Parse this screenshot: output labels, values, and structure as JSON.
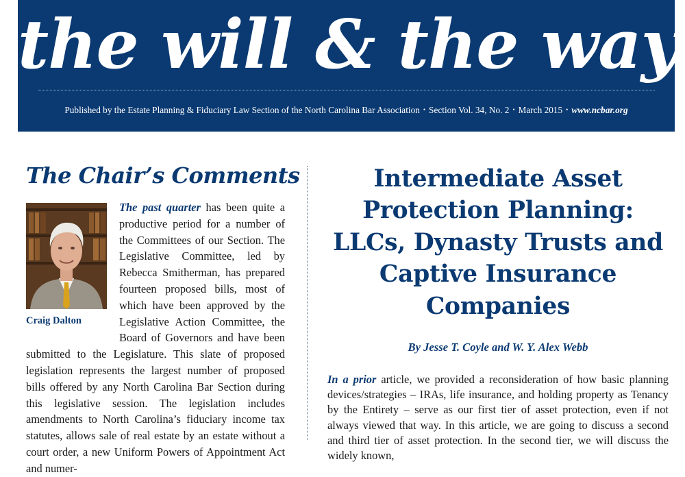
{
  "masthead": {
    "title": "the will & the way",
    "publisher": "Published by the Estate Planning & Fiduciary Law Section of the North Carolina Bar Association",
    "volume": "Section Vol. 34, No. 2",
    "date": "March 2015",
    "url": "www.ncbar.org",
    "separator": "•",
    "bg_color": "#0b3a72"
  },
  "chair": {
    "heading": "The Chair’s Comments",
    "photo_caption": "Craig Dalton",
    "lead": "The past quarter",
    "body": " has been quite a productive period for a number of the Committees of our Section. The Legislative Committee, led by Rebecca Smitherman, has prepared fourteen proposed bills, most of which have been approved by the Legislative Action Committee, the Board of Governors and have been submitted to the Legislature. This slate of proposed legislation represents the largest number of proposed bills offered by any North Carolina Bar Section during this legislative session. The legislation includes amendments to North Carolina’s fiduciary income tax statutes, allows sale of real estate by an estate without a court order, a new Uniform Powers of Appointment Act and numer-"
  },
  "article": {
    "title": "Intermediate Asset Protection Planning: LLCs, Dynasty Trusts and Captive Insurance Companies",
    "byline": "By Jesse T. Coyle and W. Y. Alex Webb",
    "lead": "In a prior",
    "body": " article, we provided a reconsideration of how basic planning devices/strategies – IRAs, life insurance, and holding property as Tenancy by the Entirety – serve as our first tier of asset protection, even if not always viewed that way. In this article, we are going to discuss a second and third tier of asset protection. In the second tier, we will discuss the widely known,"
  }
}
